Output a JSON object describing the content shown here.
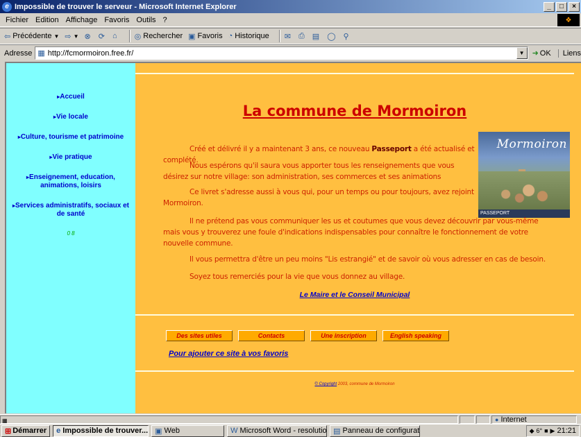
{
  "window": {
    "title": "Impossible de trouver le serveur - Microsoft Internet Explorer",
    "controls": [
      "_",
      "□",
      "×"
    ]
  },
  "menu": [
    "Fichier",
    "Edition",
    "Affichage",
    "Favoris",
    "Outils",
    "?"
  ],
  "toolbar": {
    "back": "Précédente",
    "search": "Rechercher",
    "favorites": "Favoris",
    "history": "Historique"
  },
  "address": {
    "label": "Adresse",
    "url": "http://fcmormoiron.free.fr/",
    "go": "OK",
    "links": "Liens"
  },
  "sidebar": {
    "items": [
      {
        "label": "Accueil"
      },
      {
        "label": "Vie locale"
      },
      {
        "label": "Culture, tourisme et patrimoine"
      },
      {
        "label": "Vie pratique"
      },
      {
        "label": "Enseignement, education, animations, loisirs"
      },
      {
        "label": "Services administratifs, sociaux et de santé"
      }
    ],
    "counter": "0 8"
  },
  "main": {
    "title": "La commune de Mormoiron",
    "p1_before": "Créé et délivré il y a maintenant 3 ans, ce nouveau ",
    "p1_bold": "Passeport",
    "p1_after": " a été actualisé et complété.",
    "p2": "Nous espérons qu'il saura vous apporter tous les renseignements que vous désirez sur notre village: son administration, ses commerces et ses animations",
    "p3": "Ce livret s'adresse aussi à vous qui, pour un temps ou pour toujours, avez rejoint Mormoiron.",
    "p4": "Il ne prétend pas vous communiquer les us et coutumes que vous devez découvrir par vous-même mais vous y trouverez une foule d'indications indispensables pour connaître le fonctionnement de votre nouvelle commune.",
    "p5": "Il vous permettra d'être un peu moins \"Lis estrangié\" et de savoir où vous adresser en cas de besoin.",
    "p6": "Soyez tous remerciés pour la vie que vous donnez au village.",
    "signature": "Le Maire et le Conseil Municipal",
    "photo_title": "Mormoiron",
    "photo_caption": "PASSEPORT",
    "buttons": [
      "Des sites utiles",
      "Contacts",
      "Une inscription",
      "English speaking"
    ],
    "favorites_link": "Pour ajouter ce site à vos favoris",
    "copyright_link": "© Copyright",
    "copyright_text": " 2003, commune de Mormoiron"
  },
  "status": {
    "zone": "Internet"
  },
  "taskbar": {
    "start": "Démarrer",
    "tasks": [
      {
        "label": "Impossible de trouver...",
        "active": true
      },
      {
        "label": "Web",
        "active": false
      },
      {
        "label": "Microsoft Word - resolution...",
        "active": false
      },
      {
        "label": "Panneau de configuration",
        "active": false
      }
    ],
    "clock": "21:21",
    "temp": "6°"
  }
}
